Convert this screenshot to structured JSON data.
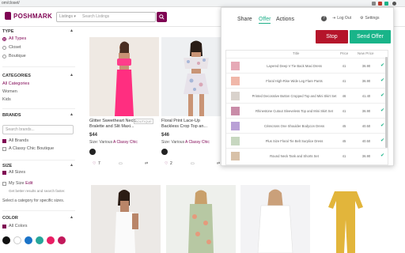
{
  "browser": {
    "url": "om/closet/"
  },
  "header": {
    "logo": "POSHMARK",
    "search_scope": "Listings ▾",
    "search_placeholder": "Search Listings"
  },
  "filters": {
    "type": {
      "heading": "TYPE",
      "options": [
        "All Types",
        "Closet",
        "Boutique"
      ]
    },
    "categories": {
      "heading": "CATEGORIES",
      "items": [
        "All Categories",
        "Women",
        "Kids"
      ]
    },
    "brands": {
      "heading": "BRANDS",
      "search_placeholder": "Search brands...",
      "options": [
        "All Brands",
        "A Classy Chic Boutique"
      ]
    },
    "size": {
      "heading": "SIZE",
      "all": "All Sizes",
      "my_size": "My Size",
      "edit": "Edit",
      "hint": "Get better results and search faster.",
      "select_hint": "Select a category for specific sizes."
    },
    "color": {
      "heading": "COLOR",
      "all": "All Colors",
      "swatches": [
        "#111111",
        "#ffffff",
        "#1a73c8",
        "#26a69a",
        "#e91e63",
        "#c2185b"
      ]
    }
  },
  "cards": [
    {
      "title": "Glitter Sweetheart Neck Bralette and Slit Maxi...",
      "tag": "BOUTIQUE",
      "price": "$44",
      "size": "Size: Various",
      "brand": "A Classy Chic",
      "likes": "7"
    },
    {
      "title": "Floral Print Lace-Up Backless Crop Top an...",
      "tag": "",
      "price": "$46",
      "size": "Size: Various",
      "brand": "A Classy Chic",
      "likes": "2"
    }
  ],
  "panel": {
    "tabs": [
      "Share",
      "Offer",
      "Actions"
    ],
    "help": "?",
    "logout": "Log Out",
    "settings": "Settings",
    "stop": "Stop",
    "send": "Send Offer",
    "columns": {
      "title": "Title",
      "price": "Price",
      "new_price": "New Price"
    },
    "rows": [
      {
        "title": "Layered Deep V Tie Back Maxi Dress",
        "price": "41",
        "new": "36.90"
      },
      {
        "title": "Floral High-Rise Wide Leg Flare Pants",
        "price": "41",
        "new": "36.90"
      },
      {
        "title": "Printed Decorative Button Cropped Top and Mini Skirt Set",
        "price": "46",
        "new": "41.40"
      },
      {
        "title": "Rhinestone Cutout Sleeveless Top and Mini Skirt Set",
        "price": "41",
        "new": "36.90"
      },
      {
        "title": "Crisscross One Shoulder Bodycon Dress",
        "price": "45",
        "new": "40.50"
      },
      {
        "title": "Plus Size Floral Tie Belt Surplice Dress",
        "price": "45",
        "new": "40.50"
      },
      {
        "title": "Round Neck Tank and Shorts Set",
        "price": "41",
        "new": "36.90"
      }
    ]
  }
}
